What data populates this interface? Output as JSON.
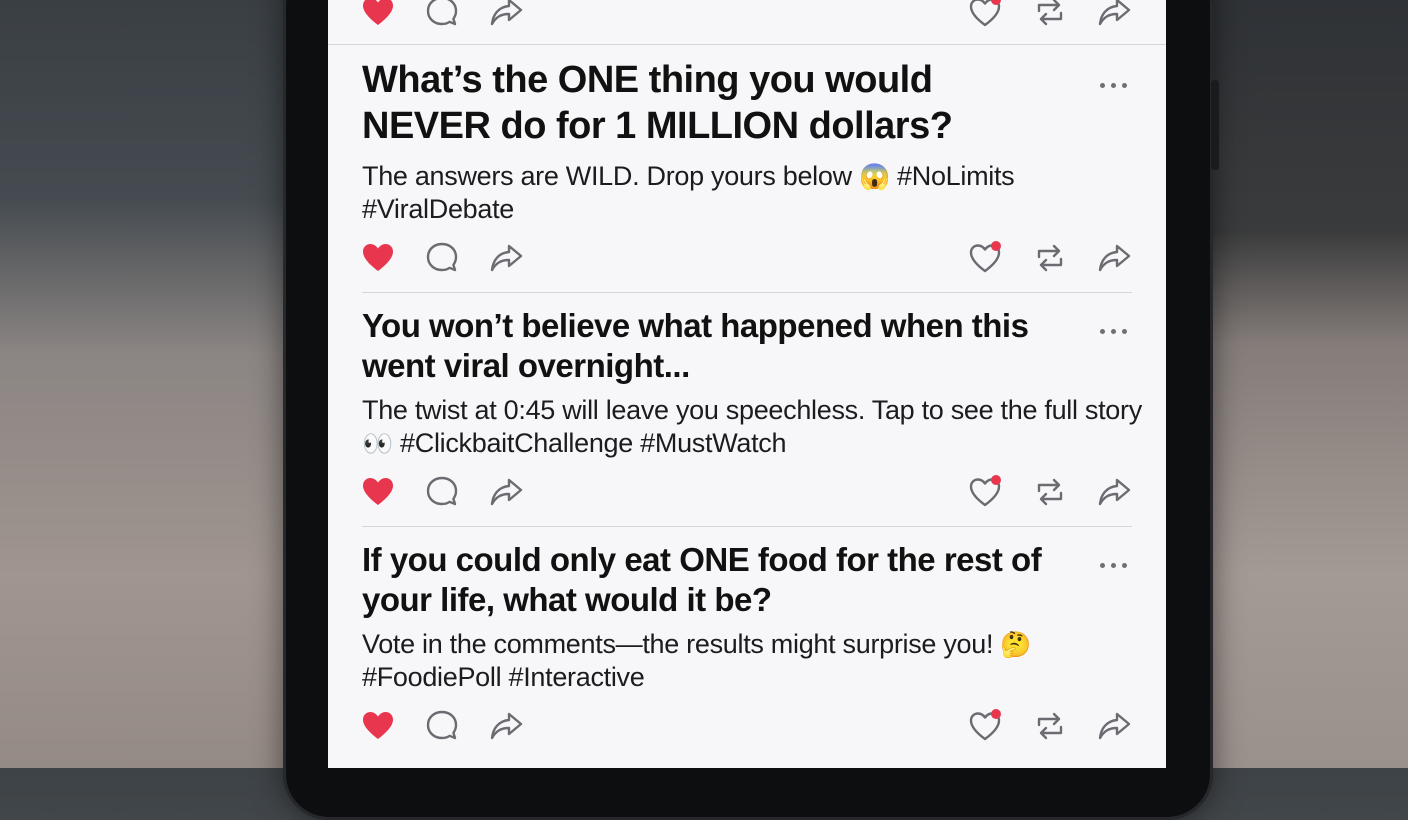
{
  "feed": {
    "posts": [
      {
        "title": "",
        "body": "",
        "hashtags": ""
      },
      {
        "title": "What’s the ONE thing you would NEVER do for 1 MILLION dollars?",
        "body": "The answers are WILD. Drop yours below",
        "emoji": "😱",
        "hashtags": "#NoLimits #ViralDebate"
      },
      {
        "title": "You won’t believe what happened when this went viral overnight...",
        "body": "The twist at 0:45 will leave you speechless. Tap to see the full story",
        "emoji": "👀",
        "hashtags": "#ClickbaitChallenge #MustWatch"
      },
      {
        "title": "If you could only eat ONE food for the rest of your life, what would it be?",
        "body": "Vote in the comments—the results might surprise you!",
        "emoji": "🤔",
        "hashtags": "#FoodiePoll #Interactive"
      }
    ],
    "actions": {
      "icons": [
        "heart-filled-icon",
        "comment-icon",
        "share-icon",
        "heart-notification-icon",
        "repost-icon",
        "forward-icon"
      ]
    }
  },
  "colors": {
    "like": "#e8364f",
    "notification_dot": "#e8364f",
    "icon_stroke": "#6a6c72",
    "divider": "#d6d6da",
    "text": "#111111"
  }
}
